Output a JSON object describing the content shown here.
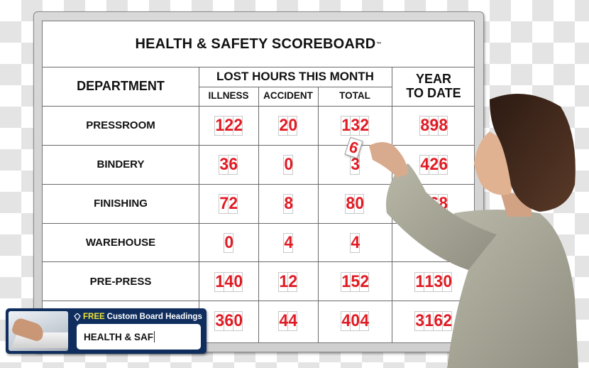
{
  "board": {
    "title": "HEALTH & SAFETY SCOREBOARD",
    "trademark": "™",
    "headers": {
      "department": "DEPARTMENT",
      "lost_hours": "LOST HOURS THIS MONTH",
      "illness": "ILLNESS",
      "accident": "ACCIDENT",
      "total": "TOTAL",
      "ytd_line1": "YEAR",
      "ytd_line2": "TO DATE"
    },
    "rows": [
      {
        "department": "PRESSROOM",
        "illness": "122",
        "accident": "20",
        "total": "132",
        "ytd": "898"
      },
      {
        "department": "BINDERY",
        "illness": "36",
        "accident": "0",
        "total": "3",
        "ytd": "426"
      },
      {
        "department": "FINISHING",
        "illness": "72",
        "accident": "8",
        "total": "80",
        "ytd": "568"
      },
      {
        "department": "WAREHOUSE",
        "illness": "0",
        "accident": "4",
        "total": "4",
        "ytd": ""
      },
      {
        "department": "PRE-PRESS",
        "illness": "140",
        "accident": "12",
        "total": "152",
        "ytd": "1130"
      },
      {
        "department": "",
        "illness": "360",
        "accident": "44",
        "total": "404",
        "ytd": "3162"
      }
    ],
    "card_being_placed": "6",
    "digit_color": "#e11b24"
  },
  "promo": {
    "icon": "leaf-logo-icon",
    "free_label": "FREE",
    "heading": "Custom Board Headings",
    "input_value": "HEALTH & SAF",
    "background_color": "#0f2e5e",
    "free_color": "#f3e533"
  }
}
